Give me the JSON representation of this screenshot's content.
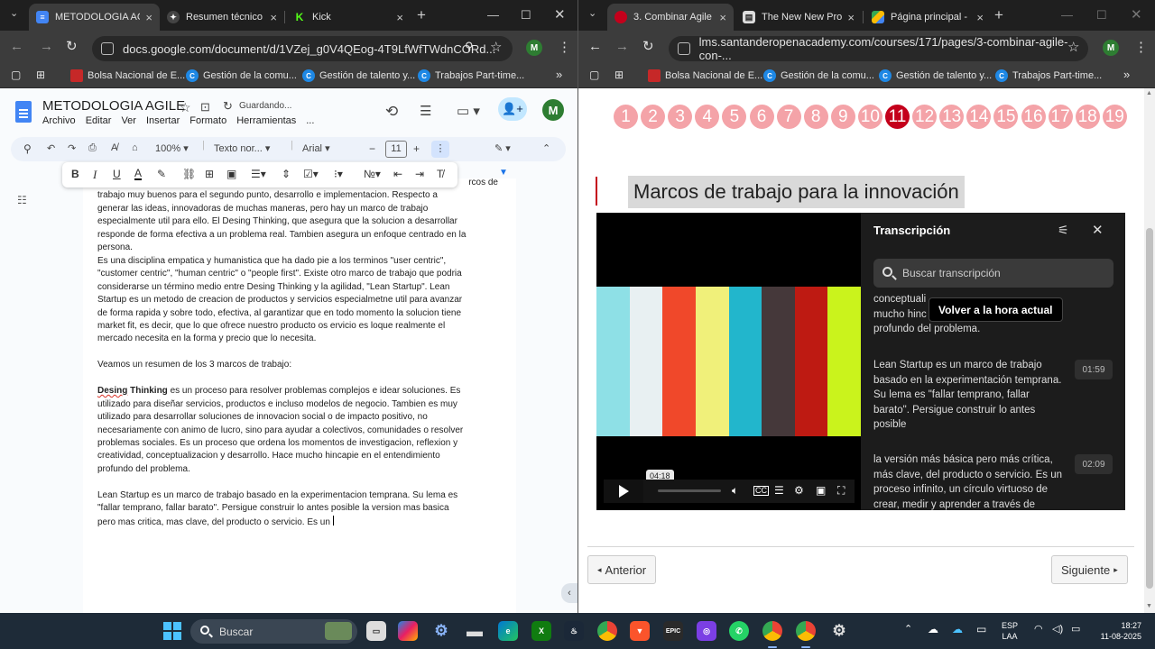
{
  "left_window": {
    "tabs": [
      {
        "title": "METODOLOGIA AGILE",
        "icon": "google-docs-icon",
        "active": true
      },
      {
        "title": "Resumen técnico d",
        "icon": "chatgpt-icon"
      },
      {
        "title": "Kick",
        "icon": "kick-icon"
      }
    ],
    "url": "docs.google.com/document/d/1VZej_g0V4QEog-4T9LfWfTWdnCORd...",
    "profile_initial": "M",
    "bookmarks": [
      "Bolsa Nacional de E...",
      "Gestión de la comu...",
      "Gestión de talento y...",
      "Trabajos Part-time..."
    ]
  },
  "docs": {
    "title": "METODOLOGIA AGILE",
    "status": "Guardando...",
    "menu": [
      "Archivo",
      "Editar",
      "Ver",
      "Insertar",
      "Formato",
      "Herramientas",
      "..."
    ],
    "zoom": "100%",
    "style": "Texto nor...",
    "font": "Arial",
    "font_size": "11",
    "account_initial": "M",
    "text": {
      "l1": "rcos de",
      "l2": "trabajo muy buenos para el segundo punto, desarrollo e implementacion. Respecto a",
      "l3": "generar las ideas, innovadoras de muchas maneras, pero hay un marco de trabajo",
      "l4": "especialmente util para ello. El Desing Thinking, que asegura que la solucion a desarrollar",
      "l5": "responde de forma efectiva a un problema real. Tambien asegura un enfoque centrado en la",
      "l6": "persona.",
      "l7": "Es una disciplina empatica y humanistica que ha dado pie a los terminos \"user centric\",",
      "l8": "\"customer centric\", \"human centric\" o \"people first\". Existe otro marco de trabajo que podria",
      "l9": "considerarse un término medio entre Desing Thinking y la agilidad, \"Lean Startup\". Lean",
      "l10": "Startup es un metodo de creacion de productos y servicios especialmetne util para avanzar",
      "l11": "de forma rapida y sobre todo, efectiva, al garantizar que en todo momento la solucion tiene",
      "l12": "market fit, es decir, que lo que ofrece nuestro producto os ervicio es loque realmente el",
      "l13": "mercado necesita en la forma y precio que lo necesita.",
      "l14": "Veamos un resumen de los 3 marcos de trabajo:",
      "l15a": "Desing",
      "l15b": "Thinking",
      "l15c": " es un proceso para resolver problemas complejos e idear soluciones. Es",
      "l16": "utilizado para diseñar servicios, productos e incluso modelos de negocio. Tambien es muy",
      "l17": "utilizado para desarrollar soluciones de innovacion social o de impacto positivo, no",
      "l18": "necesariamente con animo de lucro, sino para ayudar a colectivos, comunidades o resolver",
      "l19": "problemas sociales. Es un proceso que ordena los momentos de investigacion, reflexion y",
      "l20": "creatividad, conceptualizacion y desarrollo. Hace mucho hincapie en el entendimiento",
      "l21": "profundo del problema.",
      "l22": "Lean Startup es un marco de trabajo basado en la experimentacion temprana. Su lema es",
      "l23": "\"fallar temprano, fallar barato\". Persigue construir lo antes posible la version mas basica",
      "l24": "pero mas critica, mas clave, del producto o servicio. Es un"
    }
  },
  "right_window": {
    "tabs": [
      {
        "title": "3. Combinar Agile",
        "icon": "santander-icon",
        "active": true
      },
      {
        "title": "The New New Pro",
        "icon": "document-icon"
      },
      {
        "title": "Página principal -",
        "icon": "google-drive-icon"
      }
    ],
    "url": "lms.santanderopenacademy.com/courses/171/pages/3-combinar-agile-con-...",
    "profile_initial": "M",
    "bookmarks": [
      "Bolsa Nacional de E...",
      "Gestión de la comu...",
      "Gestión de talento y...",
      "Trabajos Part-time..."
    ]
  },
  "lms": {
    "pages": [
      "1",
      "2",
      "3",
      "4",
      "5",
      "6",
      "7",
      "8",
      "9",
      "10",
      "11",
      "12",
      "13",
      "14",
      "15",
      "16",
      "17",
      "18",
      "19"
    ],
    "current_page": "11",
    "title": "Marcos de trabajo para la innovación",
    "video": {
      "time_bubble": "04:18",
      "color_bars": [
        "#8ee0e6",
        "#e8f0f2",
        "#f0482a",
        "#f0f07a",
        "#22b6cc",
        "#45383a",
        "#be1a12",
        "#caf31c"
      ]
    },
    "transcript": {
      "heading": "Transcripción",
      "search_placeholder": "Buscar transcripción",
      "tooltip": "Volver a la hora actual",
      "seg0": [
        "conceptuali",
        "mucho hinc",
        "profundo del problema."
      ],
      "segments": [
        {
          "time": "01:59",
          "lines": [
            "Lean Startup es un marco de trabajo",
            "basado en la experimentación temprana.",
            "Su lema es \"fallar temprano, fallar",
            "barato\". Persigue construir lo antes",
            "posible"
          ]
        },
        {
          "time": "02:09",
          "lines": [
            "la versión más básica pero más crítica,",
            "más clave, del producto o servicio. Es un",
            "proceso infinito, un círculo virtuoso de",
            "crear, medir y aprender a través de"
          ]
        }
      ]
    },
    "prev": "Anterior",
    "next": "Siguiente"
  },
  "taskbar": {
    "search": "Buscar",
    "lang1": "ESP",
    "lang2": "LAA",
    "time": "18:27",
    "date": "11-08-2025"
  }
}
